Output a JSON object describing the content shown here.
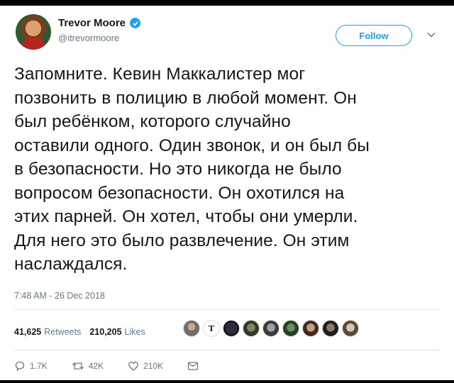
{
  "author": {
    "name": "Trevor Moore",
    "handle": "@itrevormoore"
  },
  "follow_label": "Follow",
  "tweet_lines": [
    "Запомните. Кевин Маккалистер мог",
    "позвонить в полицию в любой момент. Он",
    "был ребёнком, которого случайно",
    "оставили одного. Один звонок, и он был бы",
    "в безопасности. Но это никогда не было",
    "вопросом безопасности. Он охотился на",
    "этих парней. Он хотел, чтобы они умерли.",
    "Для него это было развлечение. Он этим",
    "наслаждался."
  ],
  "timestamp": "7:48 AM - 26 Dec 2018",
  "stats": {
    "retweets_count": "41,625",
    "retweets_label": "Retweets",
    "likes_count": "210,205",
    "likes_label": "Likes"
  },
  "actions": {
    "reply_count": "1.7K",
    "retweet_count": "42K",
    "like_count": "210K"
  },
  "colors": {
    "accent": "#1da1f2",
    "text": "#14171a",
    "muted": "#657786"
  },
  "icons": [
    "verified-badge-icon",
    "chevron-down-icon",
    "reply-icon",
    "retweet-icon",
    "like-icon",
    "dm-icon"
  ]
}
